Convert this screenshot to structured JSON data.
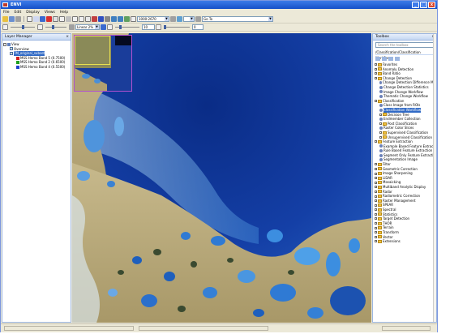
{
  "window": {
    "title": "ENVI",
    "controls": {
      "minimize": "_",
      "maximize": "□",
      "close": "x"
    }
  },
  "menu": [
    "File",
    "Edit",
    "Display",
    "Views",
    "Help"
  ],
  "toolbar": {
    "scale_value": "1000:2670",
    "goto_label": "Go To",
    "stretch_label": "Linear 2%",
    "brightness_value": "50",
    "contrast_value": "20",
    "sharpen_value": "10",
    "transparency_value": "0"
  },
  "layer_manager": {
    "title": "Layer Manager",
    "items": [
      {
        "label": "View",
        "level": 0,
        "type": "view"
      },
      {
        "label": "Overview",
        "level": 1,
        "type": "check"
      },
      {
        "label": "TM_original_subset",
        "level": 1,
        "type": "check-selected"
      },
      {
        "label": "MSS Hemo Band 5 (0.7500)",
        "level": 2,
        "color": "#d02020"
      },
      {
        "label": "MSS Hemo Band 2 (0.6500)",
        "level": 2,
        "color": "#20a020"
      },
      {
        "label": "MSS Hemo Band 4 (0.5500)",
        "level": 2,
        "color": "#2040d0"
      }
    ]
  },
  "toolbox": {
    "title": "Toolbox",
    "search_placeholder": "Search the toolbox",
    "path": "/Classification/Classification Workflow",
    "items": [
      {
        "label": "Favorites",
        "level": 0,
        "type": "folder"
      },
      {
        "label": "Anomaly Detection",
        "level": 0,
        "type": "folder"
      },
      {
        "label": "Band Ratio",
        "level": 0,
        "type": "folder"
      },
      {
        "label": "Change Detection",
        "level": 0,
        "type": "folder"
      },
      {
        "label": "Change Detection Difference Ma",
        "level": 1,
        "type": "tool"
      },
      {
        "label": "Change Detection Statistics",
        "level": 1,
        "type": "tool"
      },
      {
        "label": "Image Change Workflow",
        "level": 1,
        "type": "tool"
      },
      {
        "label": "Thematic Change Workflow",
        "level": 1,
        "type": "tool"
      },
      {
        "label": "Classification",
        "level": 0,
        "type": "folder"
      },
      {
        "label": "Class Image from ROIs",
        "level": 1,
        "type": "tool"
      },
      {
        "label": "Classification Workflow",
        "level": 1,
        "type": "tool-selected"
      },
      {
        "label": "Decision Tree",
        "level": 1,
        "type": "folder"
      },
      {
        "label": "Endmember Collection",
        "level": 1,
        "type": "tool"
      },
      {
        "label": "Post Classification",
        "level": 1,
        "type": "folder"
      },
      {
        "label": "Raster Color Slices",
        "level": 1,
        "type": "tool"
      },
      {
        "label": "Supervised Classification",
        "level": 1,
        "type": "folder"
      },
      {
        "label": "Unsupervised Classification",
        "level": 1,
        "type": "folder"
      },
      {
        "label": "Feature Extraction",
        "level": 0,
        "type": "folder"
      },
      {
        "label": "Example Based Feature Extracti",
        "level": 1,
        "type": "tool"
      },
      {
        "label": "Rule Based Feature Extraction",
        "level": 1,
        "type": "tool"
      },
      {
        "label": "Segment Only Feature Extracti",
        "level": 1,
        "type": "tool"
      },
      {
        "label": "Segmentation Image",
        "level": 1,
        "type": "tool"
      },
      {
        "label": "Filter",
        "level": 0,
        "type": "folder"
      },
      {
        "label": "Geometric Correction",
        "level": 0,
        "type": "folder"
      },
      {
        "label": "Image Sharpening",
        "level": 0,
        "type": "folder"
      },
      {
        "label": "LiDAR",
        "level": 0,
        "type": "folder"
      },
      {
        "label": "Mosaicking",
        "level": 0,
        "type": "folder"
      },
      {
        "label": "Multiband Analytic Display",
        "level": 0,
        "type": "folder"
      },
      {
        "label": "Radar",
        "level": 0,
        "type": "folder"
      },
      {
        "label": "Radiometric Correction",
        "level": 0,
        "type": "folder"
      },
      {
        "label": "Raster Management",
        "level": 0,
        "type": "folder"
      },
      {
        "label": "SPEAR",
        "level": 0,
        "type": "folder"
      },
      {
        "label": "Spectral",
        "level": 0,
        "type": "folder"
      },
      {
        "label": "Statistics",
        "level": 0,
        "type": "folder"
      },
      {
        "label": "Target Detection",
        "level": 0,
        "type": "folder"
      },
      {
        "label": "THOR",
        "level": 0,
        "type": "folder"
      },
      {
        "label": "Terrain",
        "level": 0,
        "type": "folder"
      },
      {
        "label": "Transform",
        "level": 0,
        "type": "folder"
      },
      {
        "label": "Vector",
        "level": 0,
        "type": "folder"
      },
      {
        "label": "Extensions",
        "level": 0,
        "type": "folder"
      }
    ]
  },
  "colors": {
    "sea_deep": "#0a2f8a",
    "sea_mid": "#1b4fb5",
    "land": "#b7a878",
    "lake": "#5aa0e0"
  }
}
